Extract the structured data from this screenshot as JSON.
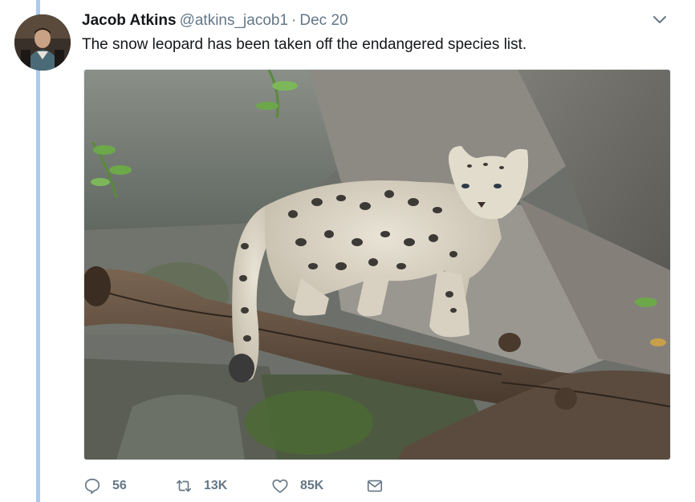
{
  "tweet": {
    "author_name": "Jacob Atkins",
    "handle": "@atkins_jacob1",
    "separator": "·",
    "date": "Dec 20",
    "text": "The snow leopard has been taken off the endangered species list.",
    "media": {
      "description_icon": "snow-leopard-photo"
    }
  },
  "actions": {
    "replies": "56",
    "retweets": "13K",
    "likes": "85K"
  },
  "icons": {
    "reply": "reply-icon",
    "retweet": "retweet-icon",
    "like": "heart-icon",
    "message": "envelope-icon",
    "menu": "chevron-down-icon"
  },
  "colors": {
    "thread_line": "#aacbed",
    "secondary_text": "#657786",
    "primary_text": "#14171a"
  }
}
